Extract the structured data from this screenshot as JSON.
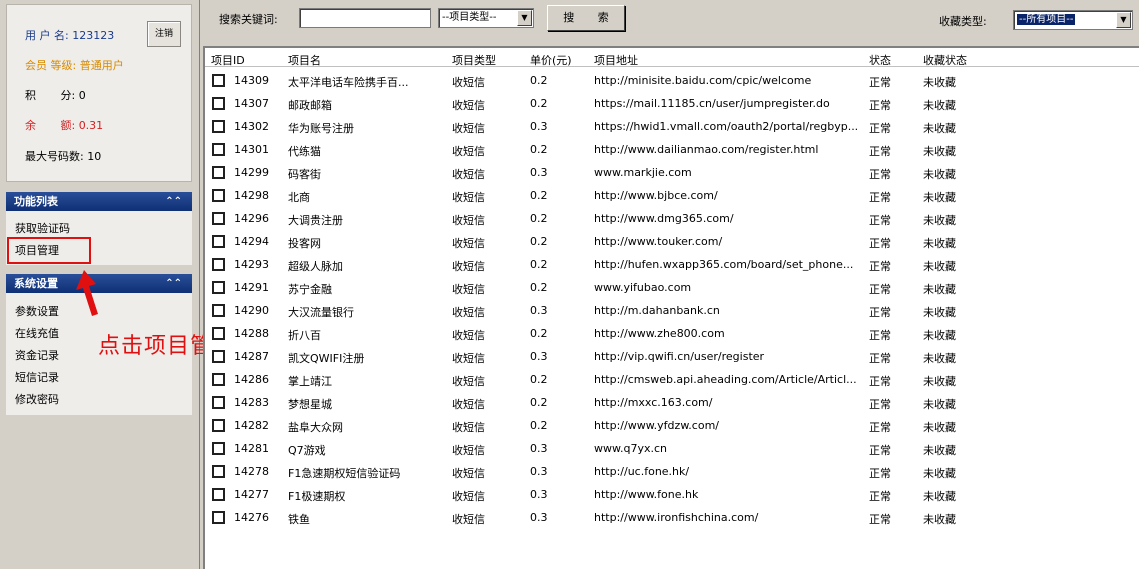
{
  "user_panel": {
    "username_label": "用 户 名:",
    "username_value": "123123",
    "logout_label": "注销",
    "level_label": "会员 等级:",
    "level_value": "普通用户",
    "points_label": "积       分:",
    "points_value": "0",
    "balance_label": "余       额:",
    "balance_value": "0.31",
    "max_codes_label": "最大号码数:",
    "max_codes_value": "10"
  },
  "function_list": {
    "title": "功能列表",
    "items": [
      "获取验证码",
      "项目管理"
    ]
  },
  "system_settings": {
    "title": "系统设置",
    "items": [
      "参数设置",
      "在线充值",
      "资金记录",
      "短信记录",
      "修改密码"
    ]
  },
  "annotation": "点击项目管理",
  "toolbar": {
    "search_label": "搜索关键词:",
    "search_value": "",
    "type_select": "--项目类型--",
    "search_button": "搜 索",
    "fav_label": "收藏类型:",
    "fav_select": "--所有项目--"
  },
  "table": {
    "headers": [
      "项目ID",
      "项目名",
      "项目类型",
      "单价(元)",
      "项目地址",
      "状态",
      "收藏状态"
    ],
    "rows": [
      {
        "id": "14309",
        "name": "太平洋电话车险携手百...",
        "type": "收短信",
        "price": "0.2",
        "url": "http://minisite.baidu.com/cpic/welcome",
        "status": "正常",
        "fav": "未收藏"
      },
      {
        "id": "14307",
        "name": "邮政邮箱",
        "type": "收短信",
        "price": "0.2",
        "url": "https://mail.11185.cn/user/jumpregister.do",
        "status": "正常",
        "fav": "未收藏"
      },
      {
        "id": "14302",
        "name": "华为账号注册",
        "type": "收短信",
        "price": "0.3",
        "url": "https://hwid1.vmall.com/oauth2/portal/regbyp...",
        "status": "正常",
        "fav": "未收藏"
      },
      {
        "id": "14301",
        "name": "代练猫",
        "type": "收短信",
        "price": "0.2",
        "url": "http://www.dailianmao.com/register.html",
        "status": "正常",
        "fav": "未收藏"
      },
      {
        "id": "14299",
        "name": "码客街",
        "type": "收短信",
        "price": "0.3",
        "url": "www.markjie.com",
        "status": "正常",
        "fav": "未收藏"
      },
      {
        "id": "14298",
        "name": "北商",
        "type": "收短信",
        "price": "0.2",
        "url": "http://www.bjbce.com/",
        "status": "正常",
        "fav": "未收藏"
      },
      {
        "id": "14296",
        "name": "大调贵注册",
        "type": "收短信",
        "price": "0.2",
        "url": "http://www.dmg365.com/",
        "status": "正常",
        "fav": "未收藏"
      },
      {
        "id": "14294",
        "name": "投客网",
        "type": "收短信",
        "price": "0.2",
        "url": "http://www.touker.com/",
        "status": "正常",
        "fav": "未收藏"
      },
      {
        "id": "14293",
        "name": "超级人脉加",
        "type": "收短信",
        "price": "0.2",
        "url": "http://hufen.wxapp365.com/board/set_phone...",
        "status": "正常",
        "fav": "未收藏"
      },
      {
        "id": "14291",
        "name": "苏宁金融",
        "type": "收短信",
        "price": "0.2",
        "url": "www.yifubao.com",
        "status": "正常",
        "fav": "未收藏"
      },
      {
        "id": "14290",
        "name": "大汉流量银行",
        "type": "收短信",
        "price": "0.3",
        "url": "http://m.dahanbank.cn",
        "status": "正常",
        "fav": "未收藏"
      },
      {
        "id": "14288",
        "name": "折八百",
        "type": "收短信",
        "price": "0.2",
        "url": "http://www.zhe800.com",
        "status": "正常",
        "fav": "未收藏"
      },
      {
        "id": "14287",
        "name": "凯文QWIFI注册",
        "type": "收短信",
        "price": "0.3",
        "url": "http://vip.qwifi.cn/user/register",
        "status": "正常",
        "fav": "未收藏"
      },
      {
        "id": "14286",
        "name": "掌上靖江",
        "type": "收短信",
        "price": "0.2",
        "url": "http://cmsweb.api.aheading.com/Article/Articl...",
        "status": "正常",
        "fav": "未收藏"
      },
      {
        "id": "14283",
        "name": "梦想星城",
        "type": "收短信",
        "price": "0.2",
        "url": "http://mxxc.163.com/",
        "status": "正常",
        "fav": "未收藏"
      },
      {
        "id": "14282",
        "name": "盐阜大众网",
        "type": "收短信",
        "price": "0.2",
        "url": "http://www.yfdzw.com/",
        "status": "正常",
        "fav": "未收藏"
      },
      {
        "id": "14281",
        "name": "Q7游戏",
        "type": "收短信",
        "price": "0.3",
        "url": "www.q7yx.cn",
        "status": "正常",
        "fav": "未收藏"
      },
      {
        "id": "14278",
        "name": "F1急速期权短信验证码",
        "type": "收短信",
        "price": "0.3",
        "url": "http://uc.fone.hk/",
        "status": "正常",
        "fav": "未收藏"
      },
      {
        "id": "14277",
        "name": "F1极速期权",
        "type": "收短信",
        "price": "0.3",
        "url": "http://www.fone.hk",
        "status": "正常",
        "fav": "未收藏"
      },
      {
        "id": "14276",
        "name": "铁鱼",
        "type": "收短信",
        "price": "0.3",
        "url": "http://www.ironfishchina.com/",
        "status": "正常",
        "fav": "未收藏"
      }
    ]
  }
}
